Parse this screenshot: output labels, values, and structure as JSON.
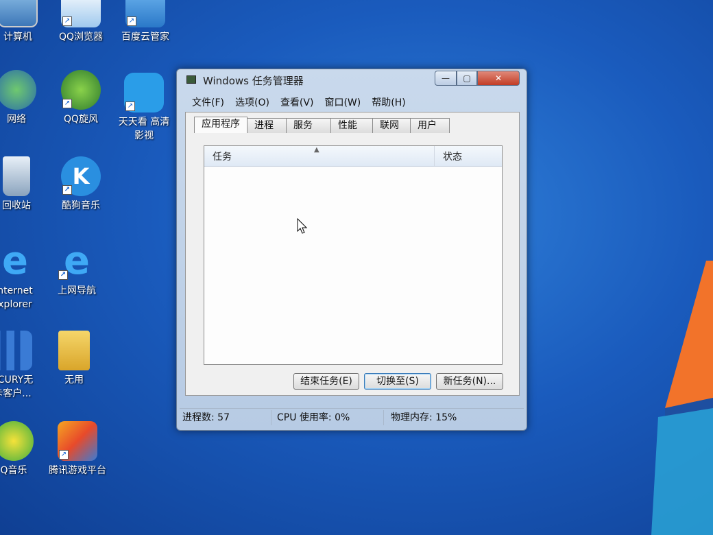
{
  "desktop": {
    "icons": [
      {
        "label": "计算机"
      },
      {
        "label": "QQ浏览器"
      },
      {
        "label": "百度云管家"
      },
      {
        "label": "网络"
      },
      {
        "label": "QQ旋风"
      },
      {
        "label": "天天看 高清",
        "label2": "影视"
      },
      {
        "label": "回收站"
      },
      {
        "label": "酷狗音乐"
      },
      {
        "label": "nternet",
        "label2": "xplorer"
      },
      {
        "label": "上网导航"
      },
      {
        "label": "RCURY无",
        "label2": "卡客户..."
      },
      {
        "label": "无用"
      },
      {
        "label": "Q音乐"
      },
      {
        "label": "腾讯游戏平台"
      }
    ],
    "colors": {
      "wallpaper": "#1a5bbd",
      "logo_red": "#e8431c",
      "logo_orange": "#f58a1f"
    }
  },
  "window": {
    "title": "Windows 任务管理器",
    "controls": {
      "minimize": "—",
      "maximize": "▢",
      "close": "✕"
    },
    "menu": [
      "文件(F)",
      "选项(O)",
      "查看(V)",
      "窗口(W)",
      "帮助(H)"
    ],
    "tabs": [
      "应用程序",
      "进程",
      "服务",
      "性能",
      "联网",
      "用户"
    ],
    "active_tab": "应用程序",
    "list": {
      "columns": [
        "任务",
        "状态"
      ],
      "rows": []
    },
    "buttons": {
      "end_task": "结束任务(E)",
      "switch_to": "切换至(S)",
      "new_task": "新任务(N)..."
    },
    "status": {
      "processes": "进程数: 57",
      "cpu": "CPU 使用率: 0%",
      "memory": "物理内存: 15%"
    }
  }
}
